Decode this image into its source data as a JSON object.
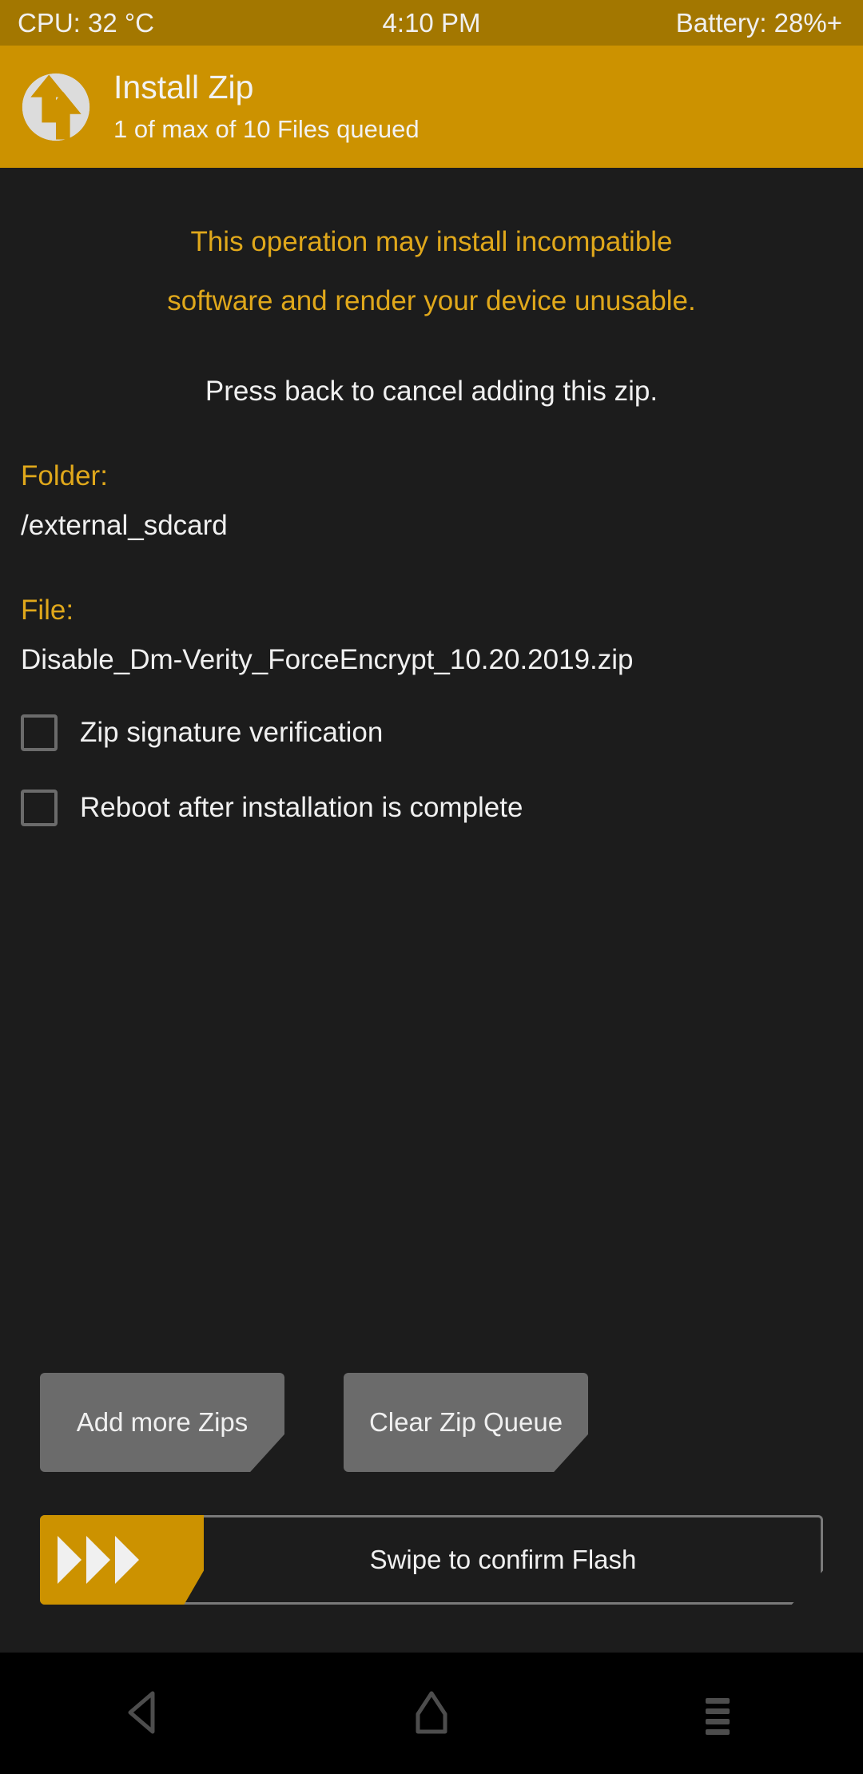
{
  "statusbar": {
    "cpu": "CPU: 32 °C",
    "time": "4:10 PM",
    "battery": "Battery: 28%+"
  },
  "header": {
    "logo_icon": "twrp-logo-icon",
    "title": "Install Zip",
    "subtitle": "1 of max of 10 Files queued"
  },
  "main": {
    "warning_line1": "This operation may install incompatible",
    "warning_line2": "software and render your device unusable.",
    "note": "Press back to cancel adding this zip.",
    "folder_label": "Folder:",
    "folder_value": "/external_sdcard",
    "file_label": "File:",
    "file_value": "Disable_Dm-Verity_ForceEncrypt_10.20.2019.zip",
    "checkboxes": [
      {
        "label": "Zip signature verification",
        "checked": false
      },
      {
        "label": "Reboot after installation is complete",
        "checked": false
      }
    ]
  },
  "actions": {
    "add_more_zips": "Add more Zips",
    "clear_zip_queue": "Clear Zip Queue",
    "swipe_label": "Swipe to confirm Flash",
    "swipe_chevron_icon": "chevron-right-icon",
    "swipe_progress_percent": 0
  },
  "navbar": {
    "back_icon": "back-triangle-icon",
    "home_icon": "home-icon",
    "menu_icon": "hamburger-menu-icon"
  },
  "colors": {
    "statusbar_bg": "#a37700",
    "header_bg": "#cc9200",
    "page_bg": "#1c1c1c",
    "accent": "#e0a81b",
    "button_bg": "#6b6b6b",
    "text": "#f0f0f0",
    "navbar_bg": "#000000"
  }
}
